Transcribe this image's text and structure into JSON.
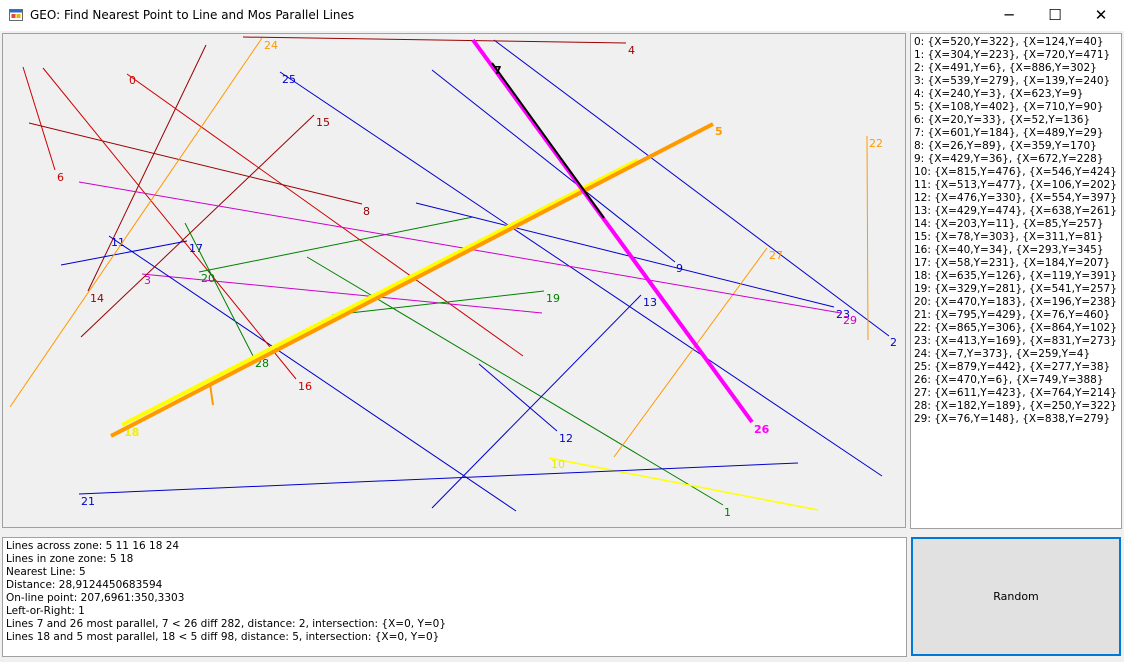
{
  "window": {
    "title": "GEO: Find Nearest Point to Line and Mos Parallel Lines",
    "minimize_glyph": "─",
    "maximize_glyph": "☐",
    "close_glyph": "✕",
    "app_icon": "app-window-icon"
  },
  "colors": {
    "accent": "#0078d7",
    "highlight_thick": "#ff9900",
    "highlight_yellow": "#ffff33",
    "highlight_magenta": "#ff00ff"
  },
  "canvas": {
    "lines": [
      {
        "id": "0",
        "color": "#cc0000"
      },
      {
        "id": "2",
        "color": "#0000cc"
      },
      {
        "id": "3",
        "color": "#cc00cc"
      },
      {
        "id": "4",
        "color": "#990000"
      },
      {
        "id": "5",
        "color": "#ff9900"
      },
      {
        "id": "6",
        "color": "#cc0000"
      },
      {
        "id": "7",
        "color": "#000000"
      },
      {
        "id": "8",
        "color": "#990000"
      },
      {
        "id": "9",
        "color": "#0000cc"
      },
      {
        "id": "10",
        "color": "#ffff00"
      },
      {
        "id": "11",
        "color": "#0000cc"
      },
      {
        "id": "12",
        "color": "#0000cc"
      },
      {
        "id": "13",
        "color": "#0000cc"
      },
      {
        "id": "14",
        "color": "#990000"
      },
      {
        "id": "15",
        "color": "#990000"
      },
      {
        "id": "16",
        "color": "#cc0000"
      },
      {
        "id": "17",
        "color": "#0000cc"
      },
      {
        "id": "18",
        "color": "#ffff00"
      },
      {
        "id": "19",
        "color": "#008000"
      },
      {
        "id": "20",
        "color": "#008000"
      },
      {
        "id": "21",
        "color": "#0000cc"
      },
      {
        "id": "22",
        "color": "#ff9900"
      },
      {
        "id": "23",
        "color": "#0000cc"
      },
      {
        "id": "24",
        "color": "#ff9900"
      },
      {
        "id": "25",
        "color": "#0000cc"
      },
      {
        "id": "26",
        "color": "#ff00ff"
      },
      {
        "id": "27",
        "color": "#ff9900"
      },
      {
        "id": "28",
        "color": "#008000"
      },
      {
        "id": "29",
        "color": "#cc00cc"
      }
    ]
  },
  "points_list": [
    "0: {X=520,Y=322}, {X=124,Y=40}",
    "1: {X=304,Y=223}, {X=720,Y=471}",
    "2: {X=491,Y=6}, {X=886,Y=302}",
    "3: {X=539,Y=279}, {X=139,Y=240}",
    "4: {X=240,Y=3}, {X=623,Y=9}",
    "5: {X=108,Y=402}, {X=710,Y=90}",
    "6: {X=20,Y=33}, {X=52,Y=136}",
    "7: {X=601,Y=184}, {X=489,Y=29}",
    "8: {X=26,Y=89}, {X=359,Y=170}",
    "9: {X=429,Y=36}, {X=672,Y=228}",
    "10: {X=815,Y=476}, {X=546,Y=424}",
    "11: {X=513,Y=477}, {X=106,Y=202}",
    "12: {X=476,Y=330}, {X=554,Y=397}",
    "13: {X=429,Y=474}, {X=638,Y=261}",
    "14: {X=203,Y=11}, {X=85,Y=257}",
    "15: {X=78,Y=303}, {X=311,Y=81}",
    "16: {X=40,Y=34}, {X=293,Y=345}",
    "17: {X=58,Y=231}, {X=184,Y=207}",
    "18: {X=635,Y=126}, {X=119,Y=391}",
    "19: {X=329,Y=281}, {X=541,Y=257}",
    "20: {X=470,Y=183}, {X=196,Y=238}",
    "21: {X=795,Y=429}, {X=76,Y=460}",
    "22: {X=865,Y=306}, {X=864,Y=102}",
    "23: {X=413,Y=169}, {X=831,Y=273}",
    "24: {X=7,Y=373}, {X=259,Y=4}",
    "25: {X=879,Y=442}, {X=277,Y=38}",
    "26: {X=470,Y=6}, {X=749,Y=388}",
    "27: {X=611,Y=423}, {X=764,Y=214}",
    "28: {X=182,Y=189}, {X=250,Y=322}",
    "29: {X=76,Y=148}, {X=838,Y=279}"
  ],
  "output_lines": [
    "Lines across zone: 5  11  16  18  24",
    "Lines in zone zone: 5  18",
    "Nearest Line: 5",
    "Distance: 28,9124450683594",
    "On-line point: 207,6961:350,3303",
    "Left-or-Right: 1",
    "Lines 7 and 26 most parallel, 7 < 26 diff 282, distance: 2, intersection: {X=0, Y=0}",
    "Lines 18 and 5 most parallel, 18 < 5 diff 98, distance: 5, intersection: {X=0, Y=0}"
  ],
  "random_button": {
    "label": "Random"
  }
}
